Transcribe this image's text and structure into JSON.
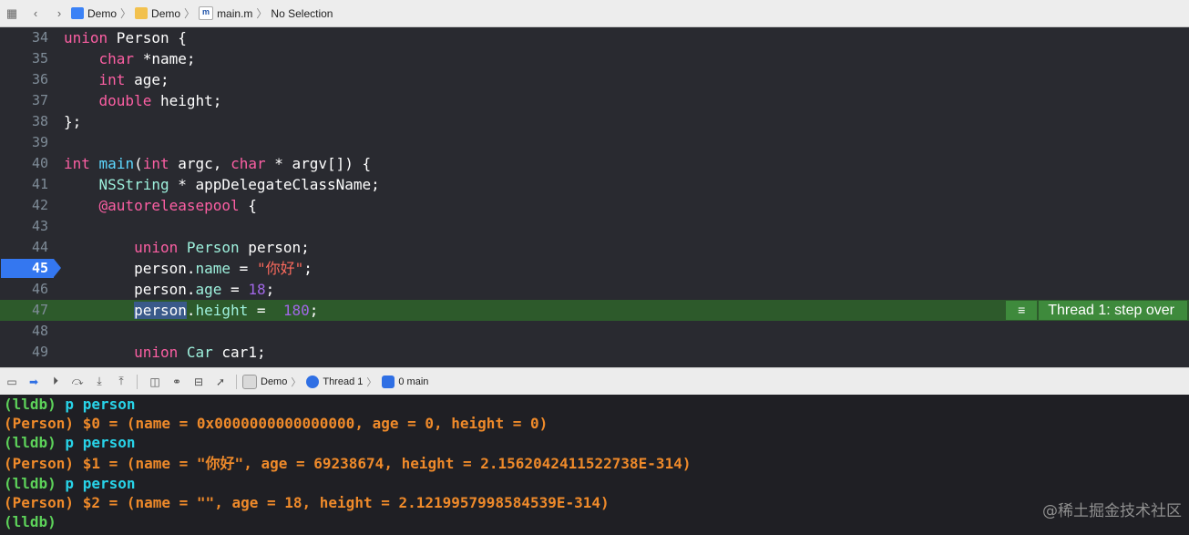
{
  "topbar": {
    "breadcrumbs": [
      "Demo",
      "Demo",
      "main.m",
      "No Selection"
    ]
  },
  "editor": {
    "lines": [
      {
        "num": "34",
        "tokens": [
          [
            "k",
            "union"
          ],
          [
            "p",
            " Person {"
          ]
        ]
      },
      {
        "num": "35",
        "tokens": [
          [
            "p",
            "    "
          ],
          [
            "k",
            "char"
          ],
          [
            "p",
            " *name;"
          ]
        ]
      },
      {
        "num": "36",
        "tokens": [
          [
            "p",
            "    "
          ],
          [
            "k",
            "int"
          ],
          [
            "p",
            " age;"
          ]
        ]
      },
      {
        "num": "37",
        "tokens": [
          [
            "p",
            "    "
          ],
          [
            "k",
            "double"
          ],
          [
            "p",
            " height;"
          ]
        ]
      },
      {
        "num": "38",
        "tokens": [
          [
            "p",
            "};"
          ]
        ]
      },
      {
        "num": "39",
        "tokens": []
      },
      {
        "num": "40",
        "tokens": [
          [
            "k",
            "int"
          ],
          [
            "p",
            " "
          ],
          [
            "t",
            "main"
          ],
          [
            "p",
            "("
          ],
          [
            "k",
            "int"
          ],
          [
            "p",
            " argc, "
          ],
          [
            "k",
            "char"
          ],
          [
            "p",
            " * argv[]) {"
          ]
        ]
      },
      {
        "num": "41",
        "tokens": [
          [
            "p",
            "    "
          ],
          [
            "ty",
            "NSString"
          ],
          [
            "p",
            " * appDelegateClassName;"
          ]
        ]
      },
      {
        "num": "42",
        "tokens": [
          [
            "p",
            "    "
          ],
          [
            "k",
            "@autoreleasepool"
          ],
          [
            "p",
            " {"
          ]
        ]
      },
      {
        "num": "43",
        "tokens": []
      },
      {
        "num": "44",
        "tokens": [
          [
            "p",
            "        "
          ],
          [
            "k",
            "union"
          ],
          [
            "p",
            " "
          ],
          [
            "ty",
            "Person"
          ],
          [
            "p",
            " person;"
          ]
        ]
      },
      {
        "num": "45",
        "tokens": [
          [
            "p",
            "        person."
          ],
          [
            "ty",
            "name"
          ],
          [
            "p",
            " = "
          ],
          [
            "s",
            "\"你好\""
          ],
          [
            "p",
            ";"
          ]
        ]
      },
      {
        "num": "46",
        "tokens": [
          [
            "p",
            "        person."
          ],
          [
            "ty",
            "age"
          ],
          [
            "p",
            " = "
          ],
          [
            "tn",
            "18"
          ],
          [
            "p",
            ";"
          ]
        ]
      },
      {
        "num": "47",
        "tokens": [
          [
            "p",
            "        "
          ],
          [
            "sel",
            "person"
          ],
          [
            "p",
            "."
          ],
          [
            "ty",
            "height"
          ],
          [
            "p",
            " = "
          ],
          [
            "tn",
            " 180"
          ],
          [
            "p",
            ";"
          ]
        ]
      },
      {
        "num": "48",
        "tokens": []
      },
      {
        "num": "49",
        "tokens": [
          [
            "p",
            "        "
          ],
          [
            "k",
            "union"
          ],
          [
            "p",
            " "
          ],
          [
            "ty",
            "Car"
          ],
          [
            "p",
            " car1;"
          ]
        ]
      }
    ],
    "breakpoint_line": "45",
    "current_line": "47",
    "thread_badge": "Thread 1: step over"
  },
  "debugbar": {
    "crumbs": [
      "Demo",
      "Thread 1",
      "0 main"
    ]
  },
  "console": {
    "lines": [
      {
        "prompt": "(lldb)",
        "cmd": " p person",
        "out": ""
      },
      {
        "prompt": "",
        "cmd": "",
        "out": "(Person) $0 = (name = 0x0000000000000000, age = 0, height = 0)"
      },
      {
        "prompt": "(lldb)",
        "cmd": " p person",
        "out": ""
      },
      {
        "prompt": "",
        "cmd": "",
        "out": "(Person) $1 = (name = \"你好\", age = 69238674, height = 2.1562042411522738E-314)"
      },
      {
        "prompt": "(lldb)",
        "cmd": " p person",
        "out": ""
      },
      {
        "prompt": "",
        "cmd": "",
        "out": "(Person) $2 = (name = \"\", age = 18, height = 2.1219957998584539E-314)"
      },
      {
        "prompt": "(lldb)",
        "cmd": "",
        "out": ""
      }
    ],
    "watermark": "@稀土掘金技术社区"
  },
  "colors": {
    "editor_bg": "#292a30",
    "keyword": "#fc5fa3",
    "type": "#9ef1dd",
    "string": "#fc6a5d",
    "number": "#a167e6",
    "breakpoint": "#3477f0",
    "current_line": "#2d5a2b",
    "console_prompt": "#5dd25a",
    "console_cmd": "#28d3e8",
    "console_out": "#ef8a2a"
  }
}
